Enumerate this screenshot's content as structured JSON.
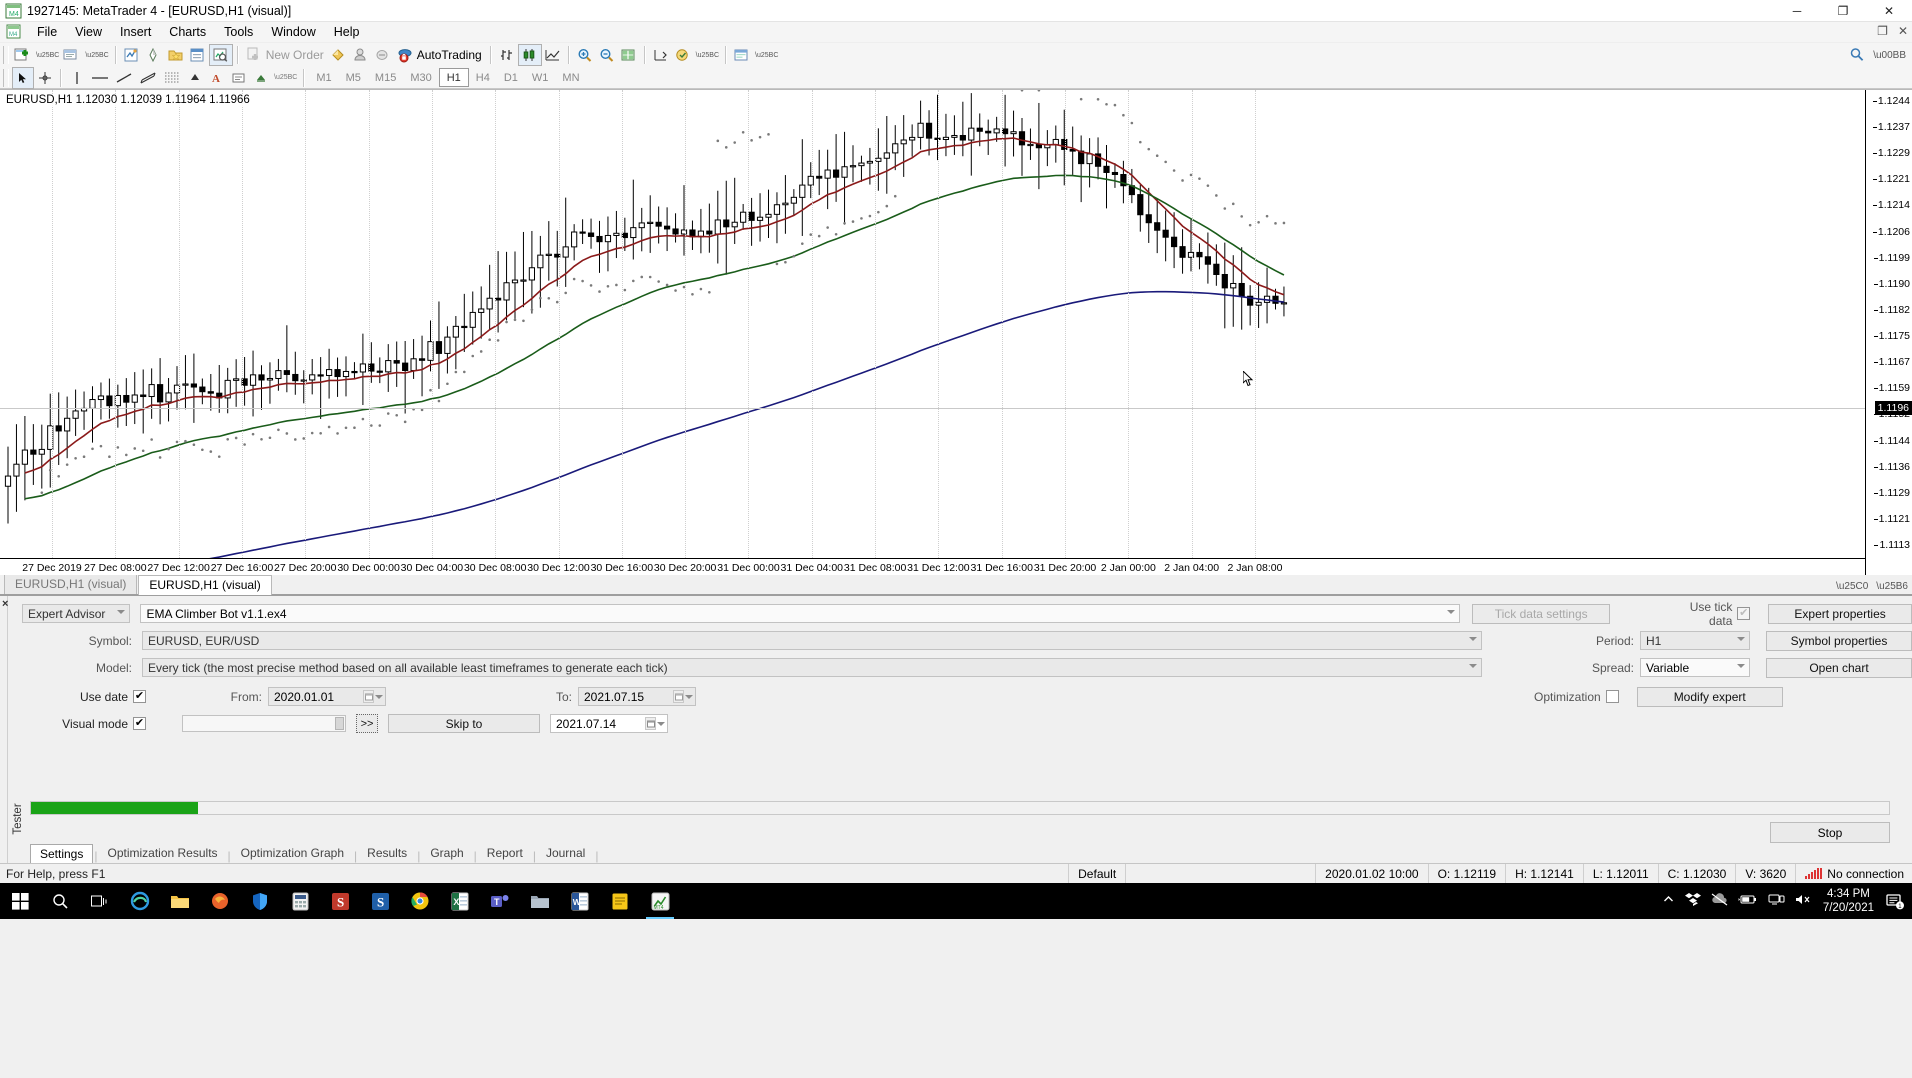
{
  "window": {
    "title": "1927145: MetaTrader 4 - [EURUSD,H1 (visual)]",
    "minimize": "─",
    "maximize": "❐",
    "close": "✕",
    "inner_restore": "❐",
    "inner_close": "✕"
  },
  "menu": {
    "items": [
      "File",
      "View",
      "Insert",
      "Charts",
      "Tools",
      "Window",
      "Help"
    ]
  },
  "toolbar_main": {
    "new_order": "New Order",
    "autotrading": "AutoTrading",
    "icons": [
      "new-chart-icon",
      "profiles-icon",
      "market-watch-icon",
      "navigator-icon",
      "data-window-icon",
      "terminal-icon",
      "new-order-icon",
      "metaeditor-icon",
      "expert-advisor-icon",
      "strategy-tester-icon",
      "autotrading-icon",
      "bar-chart-icon",
      "candlestick-chart-icon",
      "line-chart-icon",
      "zoom-in-icon",
      "zoom-out-icon",
      "tile-windows-icon",
      "chart-shift-icon",
      "auto-scroll-icon",
      "indicators-icon",
      "periods-icon",
      "templates-icon"
    ]
  },
  "toolbar_chart": {
    "timeframes": [
      "M1",
      "M5",
      "M15",
      "M30",
      "H1",
      "H4",
      "D1",
      "W1",
      "MN"
    ],
    "active_timeframe": "H1",
    "tools": [
      "cursor-icon",
      "crosshair-icon",
      "vertical-line-icon",
      "horizontal-line-icon",
      "trendline-icon",
      "equidistant-channel-icon",
      "fibonacci-icon",
      "text-icon",
      "label-icon",
      "arrows-icon"
    ]
  },
  "chart": {
    "symbol_label": "EURUSD,H1  1.12030 1.12039 1.11964 1.11966",
    "tabs": [
      {
        "label": "EURUSD,H1 (visual)",
        "active": false
      },
      {
        "label": "EURUSD,H1 (visual)",
        "active": true
      }
    ],
    "current_price": "1.1196",
    "price_ticks": [
      "1.1244",
      "1.1237",
      "1.1229",
      "1.1221",
      "1.1214",
      "1.1206",
      "1.1199",
      "1.1190",
      "1.1182",
      "1.1175",
      "1.1167",
      "1.1159",
      "1.1152",
      "1.1144",
      "1.1136",
      "1.1129",
      "1.1121",
      "1.1113"
    ],
    "time_ticks": [
      "27 Dec 2019",
      "27 Dec 08:00",
      "27 Dec 12:00",
      "27 Dec 16:00",
      "27 Dec 20:00",
      "30 Dec 00:00",
      "30 Dec 04:00",
      "30 Dec 08:00",
      "30 Dec 12:00",
      "30 Dec 16:00",
      "30 Dec 20:00",
      "31 Dec 00:00",
      "31 Dec 04:00",
      "31 Dec 08:00",
      "31 Dec 12:00",
      "31 Dec 16:00",
      "31 Dec 20:00",
      "2 Jan 00:00",
      "2 Jan 04:00",
      "2 Jan 08:00"
    ],
    "indicator_colors": {
      "ema_fast": "#8b1a1a",
      "ema_mid": "#1a5c1a",
      "ema_slow": "#1a1a7a",
      "parabolic_sar": "#7a7a7a",
      "candle_up": "#ffffff",
      "candle_down": "#000000"
    }
  },
  "tester": {
    "vertical_label": "Tester",
    "close_label": "×",
    "expert_advisor_label": "Expert Advisor",
    "expert_advisor_value": "EMA Climber Bot v1.1.ex4",
    "symbol_label": "Symbol:",
    "symbol_value": "EURUSD, EUR/USD",
    "model_label": "Model:",
    "model_value": "Every tick (the most precise method based on all available least timeframes to generate each tick)",
    "use_date_label": "Use date",
    "use_date_checked": "✔",
    "from_label": "From:",
    "from_value": "2020.01.01",
    "to_label": "To:",
    "to_value": "2021.07.15",
    "visual_mode_label": "Visual mode",
    "visual_mode_checked": "✔",
    "skip_fast_label": ">>",
    "skip_to_label": "Skip to",
    "skip_to_date": "2021.07.14",
    "tick_data_settings_label": "Tick data settings",
    "use_tick_data_label": "Use tick data",
    "use_tick_data_checked": "✔",
    "period_label": "Period:",
    "period_value": "H1",
    "spread_label": "Spread:",
    "spread_value": "Variable",
    "optimization_label": "Optimization",
    "expert_properties_label": "Expert properties",
    "symbol_properties_label": "Symbol properties",
    "open_chart_label": "Open chart",
    "modify_expert_label": "Modify expert",
    "stop_label": "Stop",
    "progress_percent": 9,
    "progress_color": "#1aa317",
    "tabs": [
      "Settings",
      "Optimization Results",
      "Optimization Graph",
      "Results",
      "Graph",
      "Report",
      "Journal"
    ],
    "active_tab": "Settings"
  },
  "statusbar": {
    "help_text": "For Help, press F1",
    "profile": "Default",
    "datetime": "2020.01.02 10:00",
    "open": "O: 1.12119",
    "high": "H: 1.12141",
    "low": "L: 1.12011",
    "close": "C: 1.12030",
    "volume": "V: 3620",
    "connection": "No connection"
  },
  "taskbar": {
    "items": [
      "start-icon",
      "search-icon",
      "task-view-icon",
      "edge-icon",
      "file-explorer-icon",
      "firefox-icon",
      "shield-icon",
      "calculator-icon",
      "s-red-icon",
      "s-blue-icon",
      "chrome-icon",
      "excel-icon",
      "teams-icon",
      "folder-icon",
      "word-icon",
      "notes-icon",
      "mt4-icon"
    ],
    "time": "4:34 PM",
    "date": "7/20/2021",
    "notification_count": "1"
  }
}
